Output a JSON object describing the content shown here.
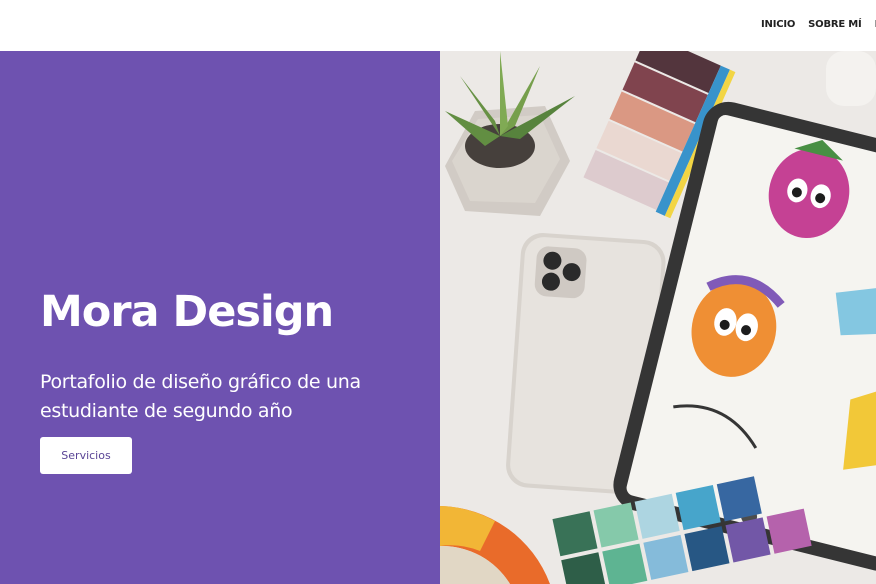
{
  "nav": {
    "items": [
      "INICIO",
      "SOBRE MÍ",
      "F"
    ]
  },
  "hero": {
    "title": "Mora Design",
    "subtitle": "Portafolio de diseño gráfico de una estudiante de segundo año",
    "button_label": "Servicios",
    "photo_icon": "design-desk-photo"
  },
  "colors": {
    "accent": "#6e52b0",
    "nav_text": "#222222",
    "button_text": "#5a4496"
  }
}
